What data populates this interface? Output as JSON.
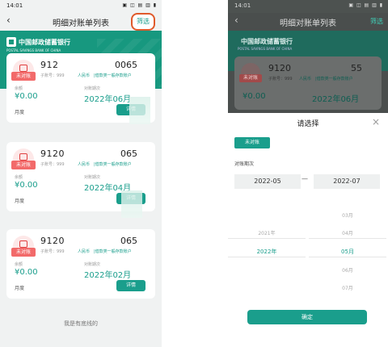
{
  "left": {
    "status": {
      "time": "14:01",
      "icons": "▣ ◫ ▤ ▥ ▮"
    },
    "nav": {
      "back": "‹",
      "title": "明细对账单列表",
      "filter": "筛选"
    },
    "banner": {
      "bank_cn": "中国邮政储蓄银行",
      "bank_en": "POSTAL SAVINGS BANK OF CHINA"
    },
    "cards": [
      {
        "badge": "未对账",
        "account": "912",
        "account_tail": "0065",
        "sub_label": "子账号：999",
        "currency": "人民币",
        "sub_account": "|借款类一般存款账户",
        "balance_label": "余额",
        "balance": "¥0.00",
        "period_label": "对账期次",
        "period": "2022年06月",
        "type": "月度",
        "detail": "详情"
      },
      {
        "badge": "未对账",
        "account": "9120",
        "account_tail": "065",
        "sub_label": "子账号：999",
        "currency": "人民币",
        "sub_account": "|借款类一般存款账户",
        "balance_label": "余额",
        "balance": "¥0.00",
        "period_label": "对账期次",
        "period": "2022年04月",
        "type": "月度",
        "detail": "详情"
      },
      {
        "badge": "未对账",
        "account": "9120",
        "account_tail": "065",
        "sub_label": "子账号：999",
        "currency": "人民币",
        "sub_account": "|借款类一般存款账户",
        "balance_label": "余额",
        "balance": "¥0.00",
        "period_label": "对账期次",
        "period": "2022年02月",
        "type": "月度",
        "detail": "详情"
      }
    ],
    "footer": "我是有底线的"
  },
  "right": {
    "status": {
      "time": "14:01",
      "icons": "▣ ◫ ▤ ▥ ▮"
    },
    "nav": {
      "back": "‹",
      "title": "明细对账单列表",
      "filter": "筛选"
    },
    "banner": {
      "bank_cn": "中国邮政储蓄银行",
      "bank_en": "POSTAL SAVINGS BANK OF CHINA"
    },
    "card": {
      "badge": "未对账",
      "account": "9120",
      "account_tail": "55",
      "sub_label": "子账号：999",
      "currency": "人民币",
      "sub_account": "|借款类一般存款账户",
      "balance": "¥0.00",
      "period": "2022年06月"
    },
    "sheet": {
      "title": "请选择",
      "close": "×",
      "chip": "未对账",
      "period_label": "对账期次",
      "start": "2022-05",
      "sep": "—",
      "end": "2022-07",
      "years": [
        "2021年",
        "2022年"
      ],
      "months": [
        "03月",
        "04月",
        "05月",
        "06月",
        "07月"
      ],
      "selected_year": "2022年",
      "selected_month": "05月",
      "confirm": "确定"
    }
  }
}
